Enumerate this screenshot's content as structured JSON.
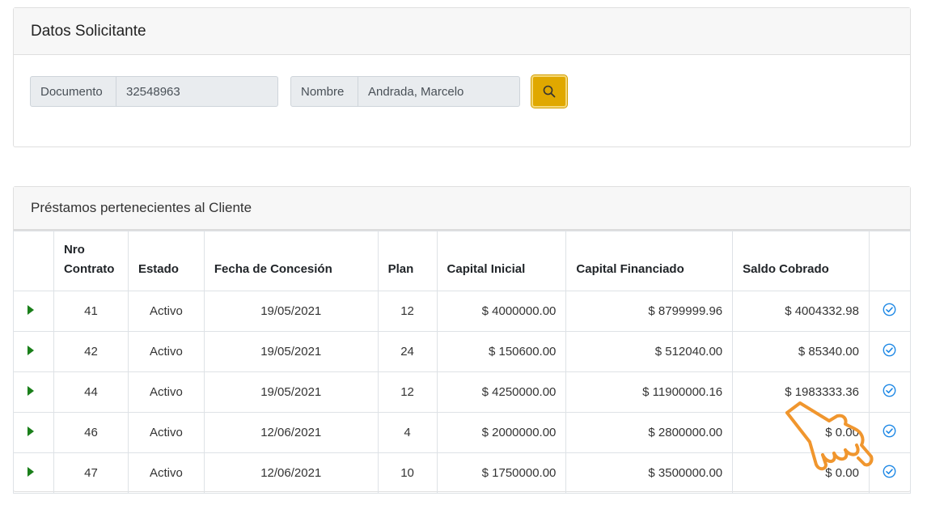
{
  "solicitante": {
    "title": "Datos Solicitante",
    "documento_label": "Documento",
    "documento_value": "32548963",
    "nombre_label": "Nombre",
    "nombre_value": "Andrada, Marcelo",
    "search_icon": "search-icon"
  },
  "prestamos": {
    "title": "Préstamos pertenecientes al Cliente",
    "columns": {
      "expand": "",
      "nro": "Nro Contrato",
      "estado": "Estado",
      "fecha": "Fecha de Concesión",
      "plan": "Plan",
      "capital_inicial": "Capital Inicial",
      "capital_financiado": "Capital Financiado",
      "saldo": "Saldo Cobrado",
      "action": ""
    },
    "rows": [
      {
        "nro": "41",
        "estado": "Activo",
        "fecha": "19/05/2021",
        "plan": "12",
        "capital_inicial": "$ 4000000.00",
        "capital_financiado": "$ 8799999.96",
        "saldo": "$ 4004332.98"
      },
      {
        "nro": "42",
        "estado": "Activo",
        "fecha": "19/05/2021",
        "plan": "24",
        "capital_inicial": "$ 150600.00",
        "capital_financiado": "$ 512040.00",
        "saldo": "$ 85340.00"
      },
      {
        "nro": "44",
        "estado": "Activo",
        "fecha": "19/05/2021",
        "plan": "12",
        "capital_inicial": "$ 4250000.00",
        "capital_financiado": "$ 11900000.16",
        "saldo": "$ 1983333.36"
      },
      {
        "nro": "46",
        "estado": "Activo",
        "fecha": "12/06/2021",
        "plan": "4",
        "capital_inicial": "$ 2000000.00",
        "capital_financiado": "$ 2800000.00",
        "saldo": "$ 0.00"
      },
      {
        "nro": "47",
        "estado": "Activo",
        "fecha": "12/06/2021",
        "plan": "10",
        "capital_inicial": "$ 1750000.00",
        "capital_financiado": "$ 3500000.00",
        "saldo": "$ 0.00"
      }
    ]
  },
  "colors": {
    "search_button": "#e0a800",
    "expand_arrow": "#1a7f1a",
    "check_icon": "#1e88e5",
    "cursor": "#f0962e"
  }
}
